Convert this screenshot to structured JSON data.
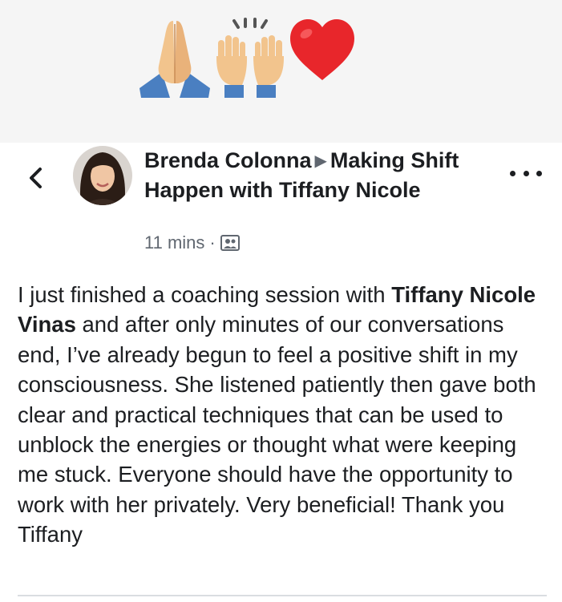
{
  "post": {
    "author": "Brenda Colonna",
    "group": "Making Shift Happen with Tiffany Nicole",
    "timestamp": "11 mins",
    "separator": "·",
    "audience_icon": "group-audience-icon",
    "text_1": "I just finished a coaching session with ",
    "mention": "Tiffany Nicole Vinas",
    "text_2": " and after only minutes of our conversations end, I’ve already begun to feel a positive shift in my consciousness.  She listened patiently then gave both clear and practical techniques that can be used to unblock the energies or thought what were keeping me stuck.  Everyone should have the opportunity to work with her privately. Very beneficial! Thank you Tiffany"
  },
  "banner": {
    "emojis": [
      "folded-hands-icon",
      "raising-hands-icon",
      "red-heart-icon"
    ]
  },
  "colors": {
    "banner_bg": "#f5f5f5",
    "text": "#1c1e21",
    "meta": "#606770",
    "heart": "#e8262b"
  }
}
